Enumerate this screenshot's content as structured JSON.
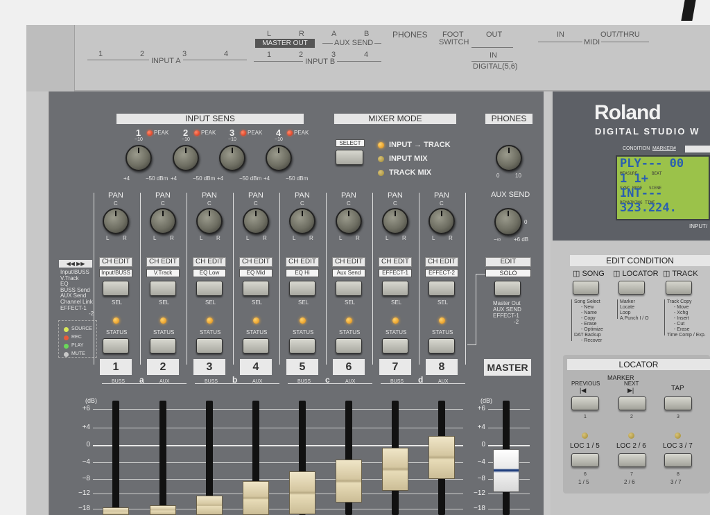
{
  "rear": {
    "input_a": [
      "1",
      "2",
      "3",
      "4"
    ],
    "input_a_label": "INPUT A",
    "master_out_lr": [
      "L",
      "R"
    ],
    "master_out_label": "MASTER OUT",
    "aux_send_ab": [
      "A",
      "B"
    ],
    "aux_send_label": "AUX SEND",
    "input_b": [
      "1",
      "2",
      "3",
      "4"
    ],
    "input_b_label": "INPUT B",
    "phones": "PHONES",
    "foot_switch_1": "FOOT",
    "foot_switch_2": "SWITCH",
    "digital_out": "OUT",
    "digital_in": "IN",
    "digital_label": "DIGITAL(5,6)",
    "midi_in": "IN",
    "midi_out": "OUT/THRU",
    "midi_label": "MIDI"
  },
  "brand": {
    "name": "Roland",
    "model": "DIGITAL STUDIO W"
  },
  "display": {
    "condition_label": "CONDITION",
    "marker_label": "MARKER#",
    "line1": "PLY---  00",
    "measure_label": "MEASURE",
    "beat_label": "BEAT",
    "line2": " 1  1+",
    "sync_label": "SYNC MODE",
    "scene_label": "SCENE",
    "line3": "INT---",
    "remaining_label": "REMAINING TIME",
    "line4": "323.224.",
    "bottom_label": "INPUT/"
  },
  "input_sens": {
    "title": "INPUT SENS",
    "channels": [
      "1",
      "2",
      "3",
      "4"
    ],
    "peak": "PEAK",
    "minus10": "−10",
    "plus4": "+4",
    "minus50": "−50 dBm"
  },
  "mixer_mode": {
    "title": "MIXER MODE",
    "select": "SELECT",
    "input_track": "INPUT → TRACK",
    "input_mix": "INPUT MIX",
    "track_mix": "TRACK MIX"
  },
  "phones": {
    "title": "PHONES",
    "min": "0",
    "max": "10"
  },
  "aux_send": {
    "title": "AUX SEND",
    "zero": "0",
    "min": "−∞",
    "max": "+6 dB"
  },
  "pan": {
    "label": "PAN",
    "c": "C",
    "l": "L",
    "r": "R"
  },
  "channels": [
    {
      "num": "1",
      "func": "Input/BUSS",
      "fader": 0.0
    },
    {
      "num": "2",
      "func": "V.Track",
      "fader": 0.02
    },
    {
      "num": "3",
      "func": "EQ Low",
      "fader": 0.1
    },
    {
      "num": "4",
      "func": "EQ Mid",
      "fader": 0.22
    },
    {
      "num": "5",
      "func": "EQ Hi",
      "fader": 0.3
    },
    {
      "num": "6",
      "func": "Aux Send",
      "fader": 0.4
    },
    {
      "num": "7",
      "func": "EFFECT-1",
      "fader": 0.5
    },
    {
      "num": "8",
      "func": "EFFECT-2",
      "fader": 0.6
    }
  ],
  "ch_edit": "CH EDIT",
  "sel": "SEL",
  "status": "STATUS",
  "buss_labels": {
    "buss": "BUSS",
    "aux": "AUX",
    "a": "a",
    "b": "b",
    "c": "c",
    "d": "d"
  },
  "left_legend": {
    "arrows": "◀◀ ▶▶",
    "lines": [
      "Input/BUSS",
      "V.Track",
      "EQ",
      "BUSS Send",
      "AUX Send",
      "Channel Link",
      "EFFECT-1",
      "-2"
    ],
    "status_legend": [
      "SOURCE",
      "REC",
      "PLAY",
      "MUTE"
    ],
    "status_colors": [
      "#d8e85a",
      "#e85a3a",
      "#6ad85a",
      "#c8c8c8"
    ]
  },
  "edit": {
    "label": "EDIT",
    "solo": "SOLO",
    "lines": [
      "Master Out",
      "AUX SEND",
      "EFFECT-1",
      "-2"
    ]
  },
  "master": {
    "label": "MASTER",
    "fader": 0.45
  },
  "scale": [
    "+6",
    "+4",
    "0",
    "−4",
    "−8",
    "−12",
    "−18"
  ],
  "scale_unit": "(dB)",
  "edit_condition": {
    "title": "EDIT CONDITION",
    "song": "SONG",
    "locator": "LOCATOR",
    "track": "TRACK",
    "song_lines": [
      "Song Select",
      "- New",
      "- Name",
      "- Copy",
      "- Erase",
      "- Optimize",
      "DAT Backup",
      "- Recover"
    ],
    "locator_lines": [
      "Marker",
      "Locate",
      "Loop",
      "A.Punch I / O"
    ],
    "track_lines": [
      "Track Copy",
      "- Move",
      "- Xchg",
      "- Insert",
      "- Cut",
      "- Erase",
      "Time Comp / Exp."
    ]
  },
  "locator": {
    "title": "LOCATOR",
    "marker": "MARKER",
    "previous": "PREVIOUS",
    "next": "NEXT",
    "tap": "TAP",
    "n1": "1",
    "n2": "2",
    "n3": "3",
    "loc1": "LOC 1 / 5",
    "loc2": "LOC 2 / 6",
    "loc3": "LOC 3 / 7",
    "n6": "6",
    "n7": "7",
    "n8": "8",
    "b1": "1 / 5",
    "b2": "2 / 6",
    "b3": "3 / 7"
  }
}
